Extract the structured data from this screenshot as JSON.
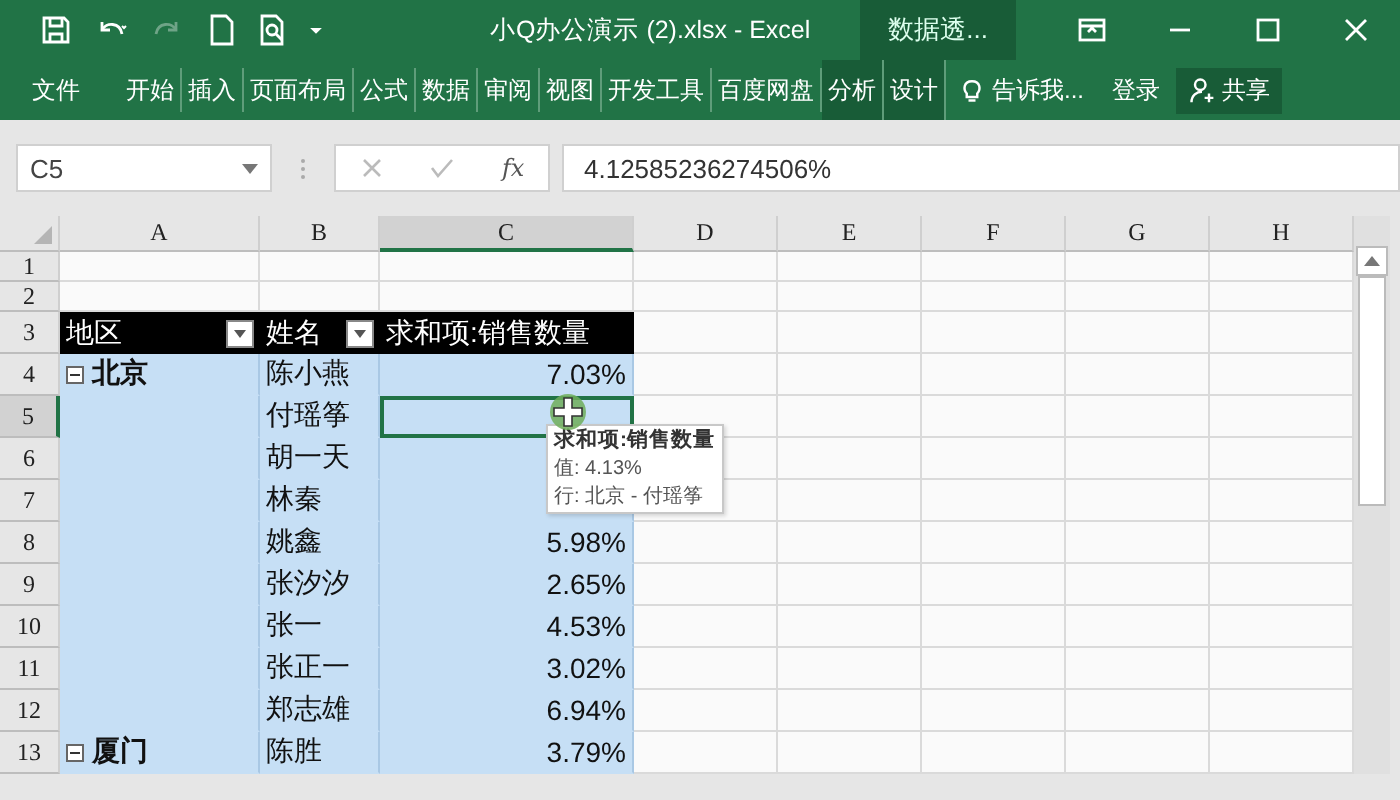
{
  "title_bar": {
    "title": "小Q办公演示 (2).xlsx - Excel",
    "context_tab": "数据透..."
  },
  "ribbon_tabs": [
    {
      "label": "文件",
      "selected": false,
      "contextual": false
    },
    {
      "label": "开始",
      "selected": false,
      "contextual": false
    },
    {
      "label": "插入",
      "selected": false,
      "contextual": false
    },
    {
      "label": "页面布局",
      "selected": false,
      "contextual": false
    },
    {
      "label": "公式",
      "selected": false,
      "contextual": false
    },
    {
      "label": "数据",
      "selected": false,
      "contextual": false
    },
    {
      "label": "审阅",
      "selected": false,
      "contextual": false
    },
    {
      "label": "视图",
      "selected": false,
      "contextual": false
    },
    {
      "label": "开发工具",
      "selected": false,
      "contextual": false
    },
    {
      "label": "百度网盘",
      "selected": false,
      "contextual": false
    },
    {
      "label": "分析",
      "selected": false,
      "contextual": true
    },
    {
      "label": "设计",
      "selected": false,
      "contextual": true
    }
  ],
  "tell_me": "告诉我...",
  "sign_in": "登录",
  "share": "共享",
  "formula_bar": {
    "name_box": "C5",
    "function_label": "fx",
    "formula": "4.12585236274506%"
  },
  "columns": [
    {
      "label": "A",
      "selected": false
    },
    {
      "label": "B",
      "selected": false
    },
    {
      "label": "C",
      "selected": true
    },
    {
      "label": "D",
      "selected": false
    },
    {
      "label": "E",
      "selected": false
    },
    {
      "label": "F",
      "selected": false
    },
    {
      "label": "G",
      "selected": false
    },
    {
      "label": "H",
      "selected": false
    }
  ],
  "rows": [
    {
      "number": "1",
      "kind": "blank",
      "selected": false
    },
    {
      "number": "2",
      "kind": "blank",
      "selected": false
    },
    {
      "number": "3",
      "kind": "header",
      "selected": false,
      "headers": [
        {
          "text": "地区",
          "filter": true
        },
        {
          "text": "姓名",
          "filter": true
        },
        {
          "text": "求和项:销售数量",
          "filter": false
        }
      ]
    },
    {
      "number": "4",
      "kind": "pivot",
      "selected": false,
      "region": "北京",
      "expanded": true,
      "name": "陈小燕",
      "value": "7.03%"
    },
    {
      "number": "5",
      "kind": "pivot",
      "selected": true,
      "name": "付瑶筝"
    },
    {
      "number": "6",
      "kind": "pivot",
      "selected": false,
      "name": "胡一天"
    },
    {
      "number": "7",
      "kind": "pivot",
      "selected": false,
      "name": "林秦"
    },
    {
      "number": "8",
      "kind": "pivot",
      "selected": false,
      "name": "姚鑫",
      "value": "5.98%"
    },
    {
      "number": "9",
      "kind": "pivot",
      "selected": false,
      "name": "张汐汐",
      "value": "2.65%"
    },
    {
      "number": "10",
      "kind": "pivot",
      "selected": false,
      "name": "张一",
      "value": "4.53%"
    },
    {
      "number": "11",
      "kind": "pivot",
      "selected": false,
      "name": "张正一",
      "value": "3.02%"
    },
    {
      "number": "12",
      "kind": "pivot",
      "selected": false,
      "name": "郑志雄",
      "value": "6.94%"
    },
    {
      "number": "13",
      "kind": "pivot",
      "selected": false,
      "region": "厦门",
      "expanded": true,
      "name": "陈胜",
      "value": "3.79%"
    }
  ],
  "tooltip": {
    "lines": [
      "求和项:销售数量",
      "值: 4.13%",
      "行: 北京 - 付瑶筝"
    ]
  }
}
